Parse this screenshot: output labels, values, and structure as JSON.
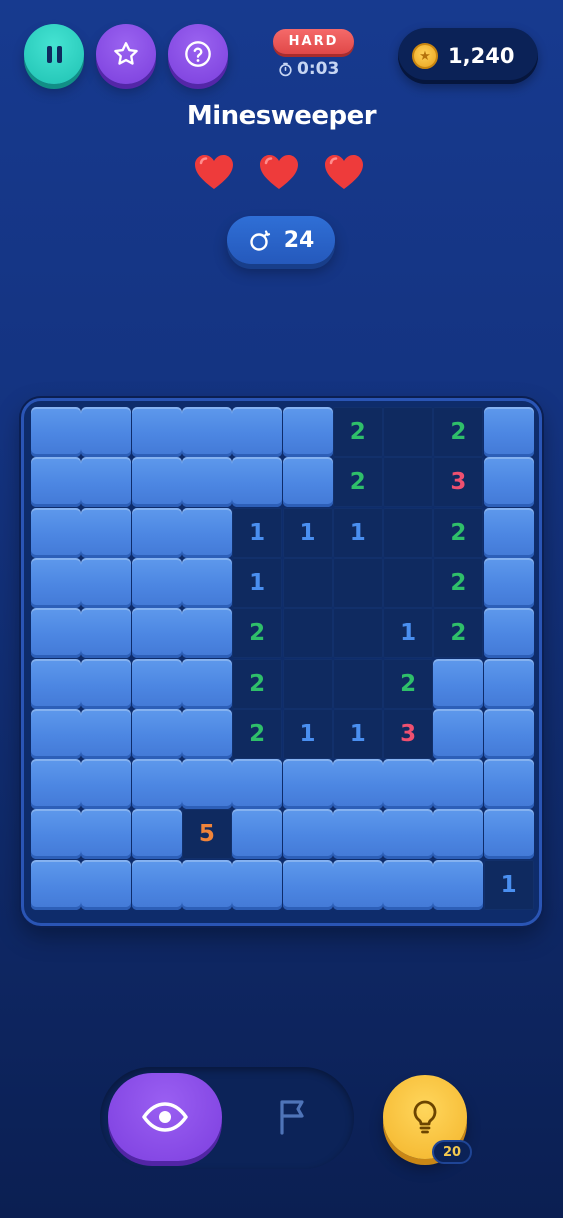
{
  "header": {
    "pause_icon": "pause-icon",
    "favorite_icon": "star-icon",
    "help_icon": "question-icon",
    "difficulty": "HARD",
    "timer": "0:03",
    "coins": "1,240"
  },
  "title": "Minesweeper",
  "lives": {
    "current": 3,
    "max": 3
  },
  "mines_remaining": "24",
  "board": {
    "rows": [
      [
        "#",
        "#",
        "#",
        "#",
        "#",
        "#",
        "2",
        ".",
        "2",
        "#"
      ],
      [
        "#",
        "#",
        "#",
        "#",
        "#",
        "#",
        "2",
        ".",
        "3",
        "#"
      ],
      [
        "#",
        "#",
        "#",
        "#",
        "1",
        "1",
        "1",
        ".",
        "2",
        "#"
      ],
      [
        "#",
        "#",
        "#",
        "#",
        "1",
        ".",
        ".",
        ".",
        "2",
        "#"
      ],
      [
        "#",
        "#",
        "#",
        "#",
        "2",
        ".",
        ".",
        "1",
        "2",
        "#"
      ],
      [
        "#",
        "#",
        "#",
        "#",
        "2",
        ".",
        ".",
        "2",
        "#",
        "#"
      ],
      [
        "#",
        "#",
        "#",
        "#",
        "2",
        "1",
        "1",
        "3",
        "#",
        "#"
      ],
      [
        "#",
        "#",
        "#",
        "#",
        "#",
        "#",
        "#",
        "#",
        "#",
        "#"
      ],
      [
        "#",
        "#",
        "#",
        "5",
        "#",
        "#",
        "#",
        "#",
        "#",
        "#"
      ],
      [
        "#",
        "#",
        "#",
        "#",
        "#",
        "#",
        "#",
        "#",
        "#",
        "1"
      ]
    ],
    "legend": {
      "#": "covered",
      ".": "revealed-empty"
    }
  },
  "controls": {
    "active_mode": "reveal",
    "reveal_icon": "eye-icon",
    "flag_icon": "flag-icon",
    "hint_icon": "lightbulb-icon",
    "hints_count": "20"
  },
  "colors": {
    "number_1": "#4a8ff0",
    "number_2": "#2fbf6a",
    "number_3": "#ef5070",
    "number_5": "#f0843a",
    "heart": "#ee3b3b",
    "difficulty_badge": "#e85252"
  }
}
